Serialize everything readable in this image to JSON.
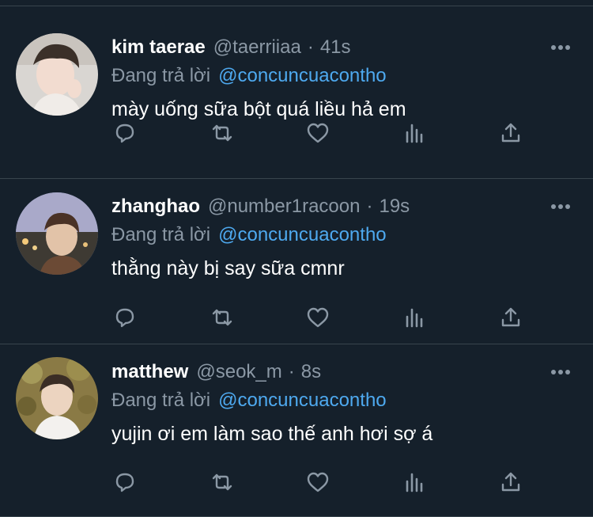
{
  "colors": {
    "background": "#15202b",
    "divider": "#38444d",
    "secondary_text": "#8b98a5",
    "mention_blue": "#4ea9ef",
    "primary_text": "#ffffff"
  },
  "tweets": [
    {
      "display_name": "kim taerae",
      "handle": "@taerriiaa",
      "separator": "·",
      "time": "41s",
      "reply_prefix": "Đang trả lời",
      "reply_to": "@concuncuacontho",
      "text": "mày uống sữa bột quá liều hả em"
    },
    {
      "display_name": "zhanghao",
      "handle": "@number1racoon",
      "separator": "·",
      "time": "19s",
      "reply_prefix": "Đang trả lời",
      "reply_to": "@concuncuacontho",
      "text": "thằng này bị say sữa cmnr"
    },
    {
      "display_name": "matthew",
      "handle": "@seok_m",
      "separator": "·",
      "time": "8s",
      "reply_prefix": "Đang trả lời",
      "reply_to": "@concuncuacontho",
      "text": "yujin ơi em làm sao thế anh hơi sợ á"
    }
  ],
  "action_icons": [
    "reply-icon",
    "retweet-icon",
    "like-icon",
    "analytics-icon",
    "share-icon"
  ]
}
